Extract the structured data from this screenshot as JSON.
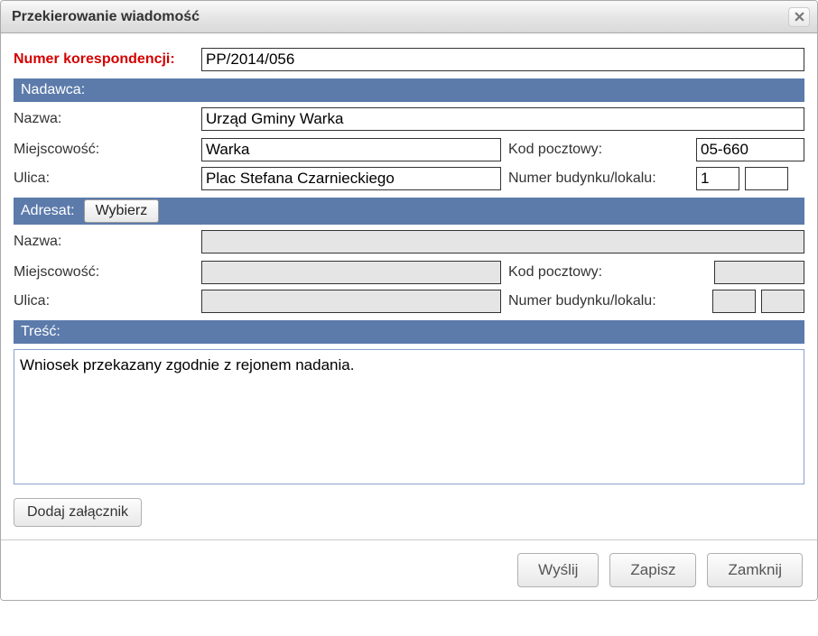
{
  "dialog": {
    "title": "Przekierowanie wiadomość"
  },
  "form": {
    "numer_label": "Numer korespondencji:",
    "numer_value": "PP/2014/056"
  },
  "nadawca": {
    "header": "Nadawca:",
    "nazwa_label": "Nazwa:",
    "nazwa_value": "Urząd Gminy Warka",
    "miejscowosc_label": "Miejscowość:",
    "miejscowosc_value": "Warka",
    "kod_label": "Kod pocztowy:",
    "kod_value": "05-660",
    "ulica_label": "Ulica:",
    "ulica_value": "Plac Stefana Czarnieckiego",
    "nr_label": "Numer budynku/lokalu:",
    "nr_bud_value": "1",
    "nr_lok_value": ""
  },
  "adresat": {
    "header": "Adresat:",
    "wybierz_label": "Wybierz",
    "nazwa_label": "Nazwa:",
    "nazwa_value": "",
    "miejscowosc_label": "Miejscowość:",
    "miejscowosc_value": "",
    "kod_label": "Kod pocztowy:",
    "kod_value": "",
    "ulica_label": "Ulica:",
    "ulica_value": "",
    "nr_label": "Numer budynku/lokalu:",
    "nr_bud_value": "",
    "nr_lok_value": ""
  },
  "tresc": {
    "header": "Treść:",
    "value": "Wniosek przekazany zgodnie z rejonem nadania."
  },
  "buttons": {
    "add_attachment": "Dodaj załącznik",
    "send": "Wyślij",
    "save": "Zapisz",
    "close": "Zamknij"
  }
}
